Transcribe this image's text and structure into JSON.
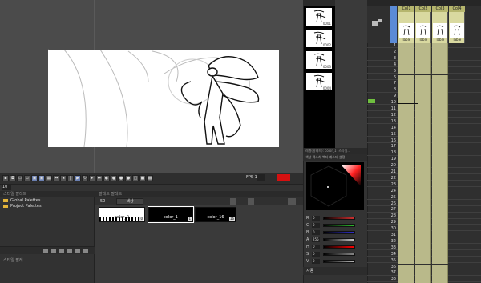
{
  "viewport": {
    "fps_label": "FPS 14",
    "fps_value": "",
    "frame": "10"
  },
  "palette_list": {
    "header": "스타일 팔레트",
    "items": [
      {
        "label": "Global Palettes"
      },
      {
        "label": "Project Palettes"
      }
    ],
    "footer": "스타일 팔레"
  },
  "level_palette": {
    "header": "팔레트 팔레트",
    "toolbar_label": "색상",
    "size_label": "50",
    "chips": [
      {
        "name": "color_0",
        "index": "0",
        "bg": "#ffffff",
        "fg": "#222222",
        "selected": false,
        "checker": true
      },
      {
        "name": "color_1",
        "index": "1",
        "bg": "#000000",
        "fg": "#ffffff",
        "selected": true,
        "checker": false
      },
      {
        "name": "color_16",
        "index": "16",
        "bg": "#000000",
        "fg": "#ffffff",
        "selected": false,
        "checker": false
      }
    ]
  },
  "filmstrip": {
    "frames": [
      "0001",
      "0002",
      "0003",
      "0004"
    ]
  },
  "style_editor": {
    "header": "레벨(팔레트): color_1 (스타일...",
    "tabs": "색상   텍스처   벡터   래스터   설정",
    "sliders": [
      {
        "label": "R",
        "value": "0",
        "color": "#d03030"
      },
      {
        "label": "G",
        "value": "0",
        "color": "#30c030"
      },
      {
        "label": "B",
        "value": "0",
        "color": "#3030d0"
      },
      {
        "label": "A",
        "value": "255",
        "color": "#cccccc"
      },
      {
        "label": "H",
        "value": "0",
        "color": "#ff0000"
      },
      {
        "label": "S",
        "value": "0",
        "color": "#888888"
      },
      {
        "label": "V",
        "value": "0",
        "color": "#bbbbbb"
      }
    ],
    "apply_label": "자동"
  },
  "xsheet": {
    "columns": [
      {
        "name": "Col1",
        "level": "Table"
      },
      {
        "name": "Col2",
        "level": "Table"
      },
      {
        "name": "Col3",
        "level": "Table"
      },
      {
        "name": "Col4",
        "level": "Table"
      }
    ],
    "rows": [
      "1",
      "2",
      "3",
      "4",
      "5",
      "6",
      "7",
      "8",
      "9",
      "10",
      "11",
      "12",
      "13",
      "14",
      "15",
      "16",
      "17",
      "18",
      "19",
      "20",
      "21",
      "22",
      "23",
      "24",
      "25",
      "26",
      "27",
      "28",
      "29",
      "30",
      "31",
      "32",
      "33",
      "34",
      "35",
      "36",
      "37",
      "38"
    ],
    "current_frame": "10"
  }
}
